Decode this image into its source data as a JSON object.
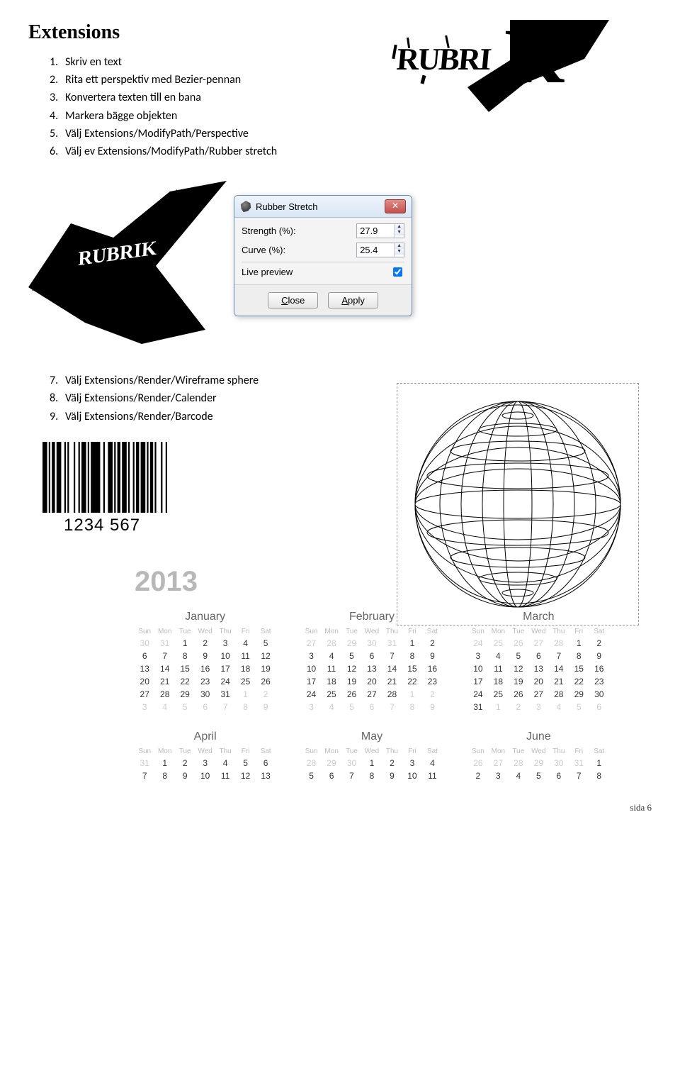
{
  "heading": "Extensions",
  "list1": [
    "Skriv en text",
    "Rita ett perspektiv med Bezier-pennan",
    "Konvertera texten till en bana",
    "Markera bägge objekten",
    "Välj Extensions/ModifyPath/Perspective",
    "Välj ev Extensions/ModifyPath/Rubber stretch"
  ],
  "dialog": {
    "title": "Rubber Stretch",
    "strength_label": "Strength (%):",
    "strength_value": "27.9",
    "curve_label": "Curve (%):",
    "curve_value": "25.4",
    "live_preview": "Live preview",
    "close": "Close",
    "apply": "Apply"
  },
  "list2": [
    "Välj Extensions/Render/Wireframe sphere",
    "Välj Extensions/Render/Calender",
    "Välj Extensions/Render/Barcode"
  ],
  "barcode_text": "1234   567",
  "calendar": {
    "year": "2013",
    "dow": [
      "Sun",
      "Mon",
      "Tue",
      "Wed",
      "Thu",
      "Fri",
      "Sat"
    ],
    "months_row1": [
      {
        "name": "January",
        "lead": 2,
        "prev": [
          30,
          31
        ],
        "days": 31,
        "trail": [
          1,
          2,
          3,
          4,
          5,
          6,
          7,
          8,
          9
        ]
      },
      {
        "name": "February",
        "lead": 5,
        "prev": [
          27,
          28,
          29,
          30,
          31
        ],
        "days": 28,
        "trail": [
          1,
          2,
          3,
          4,
          5,
          6,
          7,
          8,
          9
        ]
      },
      {
        "name": "March",
        "lead": 5,
        "prev": [
          24,
          25,
          26,
          27,
          28
        ],
        "days": 31,
        "trail": [
          1,
          2,
          3,
          4,
          5,
          6
        ]
      }
    ],
    "months_row2": [
      {
        "name": "April",
        "lead": 1,
        "prev": [
          31
        ],
        "days": 13,
        "trail": []
      },
      {
        "name": "May",
        "lead": 3,
        "prev": [
          28,
          29,
          30
        ],
        "days": 11,
        "trail": []
      },
      {
        "name": "June",
        "lead": 6,
        "prev": [
          26,
          27,
          28,
          29,
          30,
          31
        ],
        "days": 8,
        "trail": []
      }
    ]
  },
  "footer": "sida 6"
}
